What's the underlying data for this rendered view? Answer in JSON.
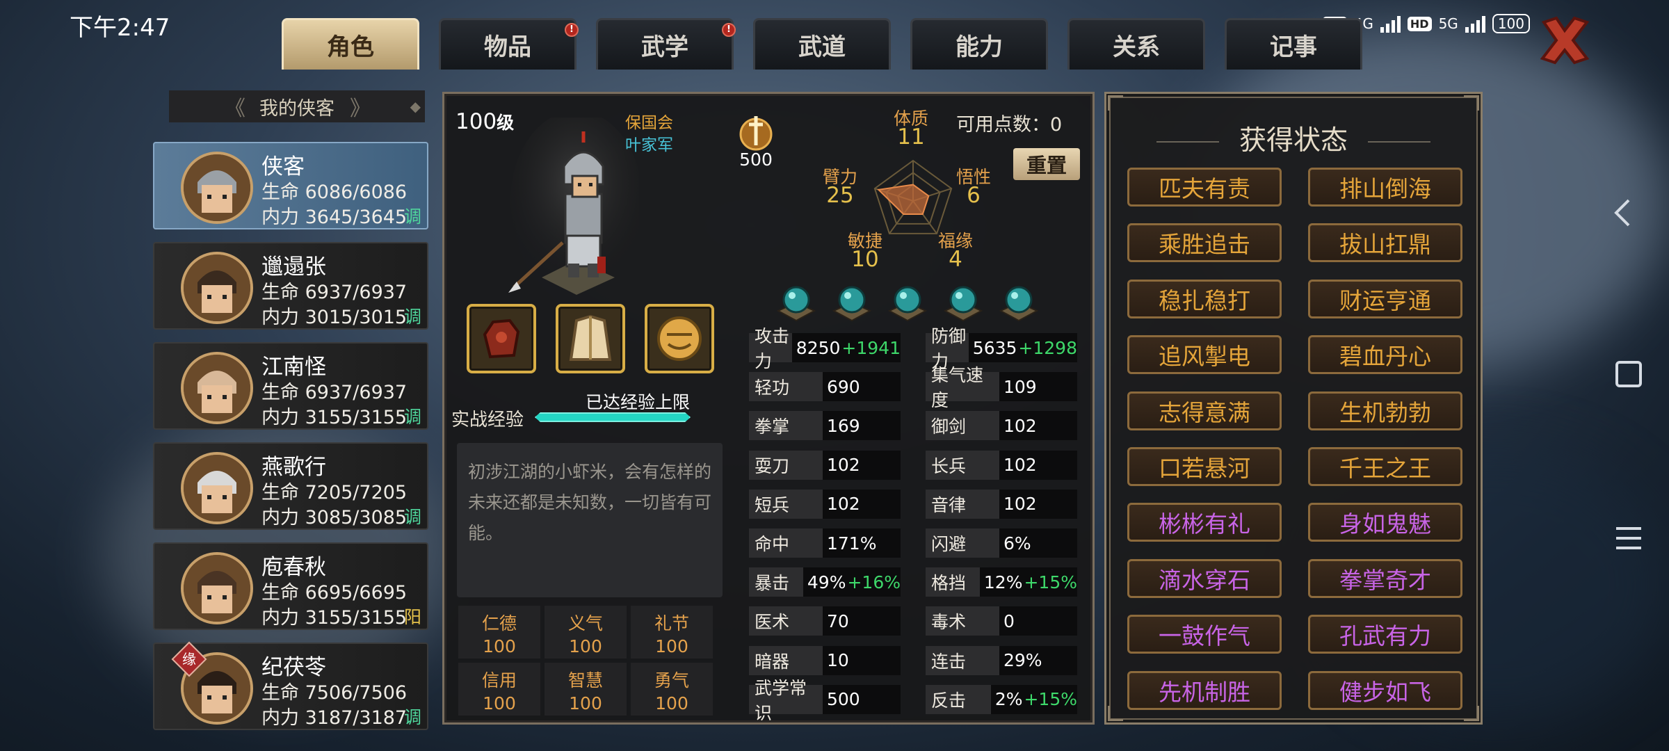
{
  "status_bar": {
    "time": "下午2:47",
    "hd1": "HD",
    "net1": "4G",
    "hd2": "HD",
    "net2": "5G",
    "battery": "100"
  },
  "tabs": [
    {
      "label": "角色",
      "active": true,
      "alert": false
    },
    {
      "label": "物品",
      "active": false,
      "alert": true
    },
    {
      "label": "武学",
      "active": false,
      "alert": true
    },
    {
      "label": "武道",
      "active": false,
      "alert": false
    },
    {
      "label": "能力",
      "active": false,
      "alert": false
    },
    {
      "label": "关系",
      "active": false,
      "alert": false
    },
    {
      "label": "记事",
      "active": false,
      "alert": false
    }
  ],
  "alert_mark": "!",
  "sidebar": {
    "title": "我的侠客",
    "heroes": [
      {
        "name": "侠客",
        "hp": "生命 6086/6086",
        "mp": "内力 3645/3645",
        "tag": "调",
        "selected": true
      },
      {
        "name": "邋遢张",
        "hp": "生命 6937/6937",
        "mp": "内力 3015/3015",
        "tag": "调"
      },
      {
        "name": "江南怪",
        "hp": "生命 6937/6937",
        "mp": "内力 3155/3155",
        "tag": "调"
      },
      {
        "name": "燕歌行",
        "hp": "生命 7205/7205",
        "mp": "内力 3085/3085",
        "tag": "调"
      },
      {
        "name": "庖春秋",
        "hp": "生命 6695/6695",
        "mp": "内力 3155/3155",
        "tag": "阳"
      },
      {
        "name": "纪茯苓",
        "hp": "生命 7506/7506",
        "mp": "内力 3187/3187",
        "tag": "调",
        "fate": "缘"
      }
    ]
  },
  "character": {
    "level_num": "100",
    "level_unit": "级",
    "org": "保国会",
    "title": "叶家军",
    "token": "500",
    "points_label": "可用点数：",
    "points": "0",
    "reset": "重置",
    "radar": {
      "体质": "11",
      "悟性": "6",
      "福缘": "4",
      "敏捷": "10",
      "臂力": "25"
    },
    "radar_labels": {
      "top": "体质",
      "right": "悟性",
      "br": "福缘",
      "bl": "敏捷",
      "left": "臂力"
    },
    "radar_levels": [
      25,
      11,
      6,
      4,
      10
    ],
    "exp_label": "实战经验",
    "exp_status": "已达经验上限",
    "exp_fraction": 1.0,
    "description": "初涉江湖的小虾米，会有怎样的未来还都是未知数，一切皆有可能。",
    "virtues": [
      {
        "l": "仁德",
        "v": "100"
      },
      {
        "l": "义气",
        "v": "100"
      },
      {
        "l": "礼节",
        "v": "100"
      },
      {
        "l": "信用",
        "v": "100"
      },
      {
        "l": "智慧",
        "v": "100"
      },
      {
        "l": "勇气",
        "v": "100"
      }
    ],
    "stats_left": [
      {
        "l": "攻击力",
        "v": "8250",
        "b": "+1941"
      },
      {
        "l": "轻功",
        "v": "690"
      },
      {
        "l": "拳掌",
        "v": "169"
      },
      {
        "l": "耍刀",
        "v": "102"
      },
      {
        "l": "短兵",
        "v": "102"
      },
      {
        "l": "命中",
        "v": "171%"
      },
      {
        "l": "暴击",
        "v": "49%",
        "b": "+16%"
      },
      {
        "l": "医术",
        "v": "70"
      },
      {
        "l": "暗器",
        "v": "10"
      },
      {
        "l": "武学常识",
        "v": "500"
      }
    ],
    "stats_right": [
      {
        "l": "防御力",
        "v": "5635",
        "b": "+1298"
      },
      {
        "l": "集气速度",
        "v": "109"
      },
      {
        "l": "御剑",
        "v": "102"
      },
      {
        "l": "长兵",
        "v": "102"
      },
      {
        "l": "音律",
        "v": "102"
      },
      {
        "l": "闪避",
        "v": "6%"
      },
      {
        "l": "格挡",
        "v": "12%",
        "b": "+15%"
      },
      {
        "l": "毒术",
        "v": "0"
      },
      {
        "l": "连击",
        "v": "29%"
      },
      {
        "l": "反击",
        "v": "2%",
        "b": "+15%"
      }
    ]
  },
  "status_panel": {
    "title": "获得状态",
    "items": [
      {
        "t": "匹夫有责",
        "c": "gold"
      },
      {
        "t": "排山倒海",
        "c": "gold"
      },
      {
        "t": "乘胜追击",
        "c": "gold"
      },
      {
        "t": "拔山扛鼎",
        "c": "gold"
      },
      {
        "t": "稳扎稳打",
        "c": "gold"
      },
      {
        "t": "财运亨通",
        "c": "gold"
      },
      {
        "t": "追风掣电",
        "c": "gold"
      },
      {
        "t": "碧血丹心",
        "c": "gold"
      },
      {
        "t": "志得意满",
        "c": "gold"
      },
      {
        "t": "生机勃勃",
        "c": "gold"
      },
      {
        "t": "口若悬河",
        "c": "gold"
      },
      {
        "t": "千王之王",
        "c": "gold"
      },
      {
        "t": "彬彬有礼",
        "c": "purple"
      },
      {
        "t": "身如鬼魅",
        "c": "purple"
      },
      {
        "t": "滴水穿石",
        "c": "purple"
      },
      {
        "t": "拳掌奇才",
        "c": "purple"
      },
      {
        "t": "一鼓作气",
        "c": "purple"
      },
      {
        "t": "孔武有力",
        "c": "purple"
      },
      {
        "t": "先机制胜",
        "c": "purple"
      },
      {
        "t": "健步如飞",
        "c": "purple"
      }
    ]
  },
  "colors": {
    "gold": "#e5a53a",
    "purple": "#c864e6",
    "bonus": "#3ed86a",
    "tag": "#4fd69c"
  }
}
